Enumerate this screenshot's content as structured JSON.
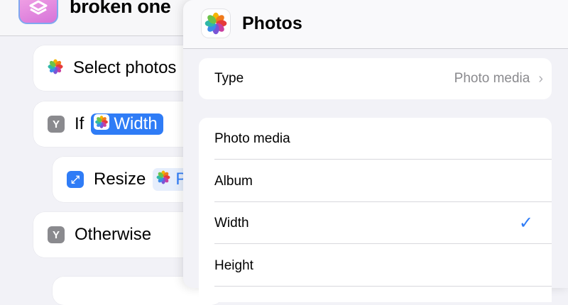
{
  "shortcut": {
    "title": "broken one",
    "actions": [
      {
        "label": "Select photos"
      },
      {
        "label": "If",
        "token": "Width"
      },
      {
        "label": "Resize",
        "token": "P"
      },
      {
        "label": "Otherwise"
      }
    ]
  },
  "popover": {
    "title": "Photos",
    "type_row": {
      "label": "Type",
      "value": "Photo media"
    },
    "options": [
      {
        "label": "Photo media",
        "selected": false
      },
      {
        "label": "Album",
        "selected": false
      },
      {
        "label": "Width",
        "selected": true
      },
      {
        "label": "Height",
        "selected": false
      }
    ],
    "check_glyph": "✓",
    "chevron_glyph": "›"
  },
  "colors": {
    "accent": "#2f7cf6",
    "background": "#f2f2f7",
    "app_icon": "#d673d9"
  }
}
